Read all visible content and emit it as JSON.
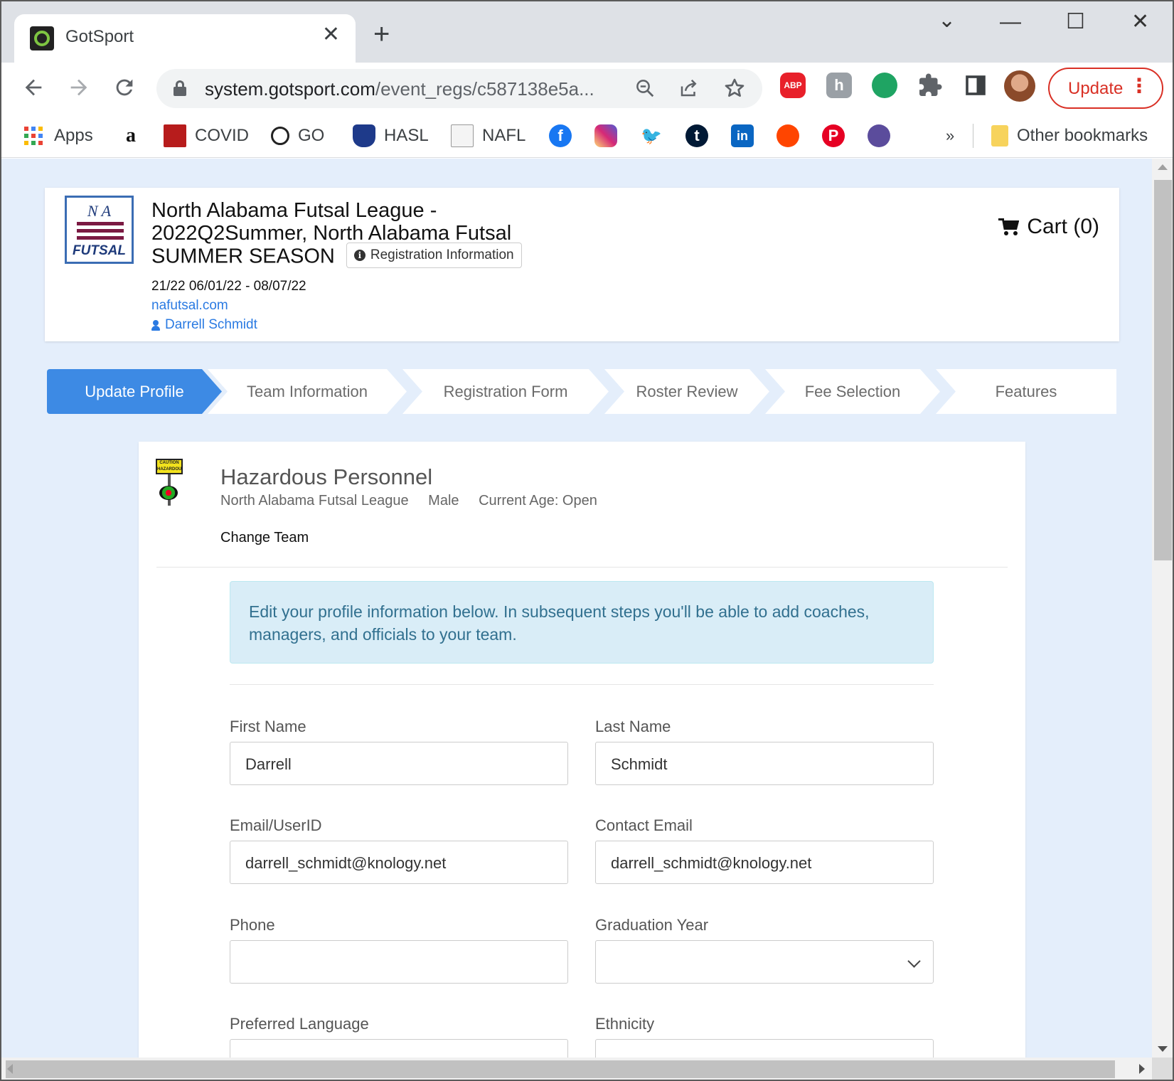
{
  "browser": {
    "tab_title": "GotSport",
    "tab_close": "✕",
    "new_tab": "+",
    "window_controls": {
      "dropdown": "⌄",
      "minimize": "—",
      "maximize": "☐",
      "close": "✕"
    },
    "url_host": "system.gotsport.com",
    "url_path": "/event_regs/c587138e5a...",
    "update_label": "Update",
    "kebab": "⋮",
    "ext_abp": "ABP",
    "bookmarks": {
      "apps": "Apps",
      "amazon": "a",
      "covid": "COVID",
      "go": "GO",
      "hasl": "HASL",
      "nafl": "NAFL",
      "more": "»",
      "other": "Other bookmarks",
      "social_glyphs": {
        "facebook": "f",
        "tumblr": "t",
        "linkedin": "in",
        "twitter": "🐦",
        "pinterest": "P"
      }
    },
    "icons": [
      "back-icon",
      "forward-icon",
      "reload-icon",
      "lock-icon",
      "zoom-icon",
      "share-icon",
      "star-icon",
      "puzzle-icon",
      "sidepanel-icon"
    ]
  },
  "event": {
    "title": "North Alabama Futsal League - 2022Q2Summer, North Alabama Futsal SUMMER SEASON",
    "reg_info_label": "Registration Information",
    "dates": "21/22 06/01/22 - 08/07/22",
    "website": "nafutsal.com",
    "user": "Darrell Schmidt",
    "cart_label": "Cart (0)",
    "logo_text": {
      "initials": "N A",
      "name": "FUTSAL"
    }
  },
  "steps": [
    {
      "label": "Update Profile",
      "active": true
    },
    {
      "label": "Team Information",
      "active": false
    },
    {
      "label": "Registration Form",
      "active": false
    },
    {
      "label": "Roster Review",
      "active": false
    },
    {
      "label": "Fee Selection",
      "active": false
    },
    {
      "label": "Features",
      "active": false
    }
  ],
  "team": {
    "name": "Hazardous Personnel",
    "league": "North Alabama Futsal League",
    "gender": "Male",
    "age": "Current Age: Open",
    "change_team": "Change Team",
    "logo_sign_text": "CAUTION HAZARDOUS PERSONNEL"
  },
  "alert_text": "Edit your profile information below. In subsequent steps you'll be able to add coaches, managers, and officials to your team.",
  "form": {
    "first_name": {
      "label": "First Name",
      "value": "Darrell"
    },
    "last_name": {
      "label": "Last Name",
      "value": "Schmidt"
    },
    "email_userid": {
      "label": "Email/UserID",
      "value": "darrell_schmidt@knology.net"
    },
    "contact_email": {
      "label": "Contact Email",
      "value": "darrell_schmidt@knology.net"
    },
    "phone": {
      "label": "Phone",
      "value": ""
    },
    "graduation_year": {
      "label": "Graduation Year",
      "value": ""
    },
    "preferred_language": {
      "label": "Preferred Language",
      "value": ""
    },
    "ethnicity": {
      "label": "Ethnicity",
      "value": ""
    }
  },
  "colors": {
    "accent": "#3d8ae4",
    "link": "#2a7ae2",
    "page_bg": "#e4eefb",
    "alert_bg": "#d9edf7",
    "alert_text": "#31708f",
    "update_red": "#d93025"
  }
}
